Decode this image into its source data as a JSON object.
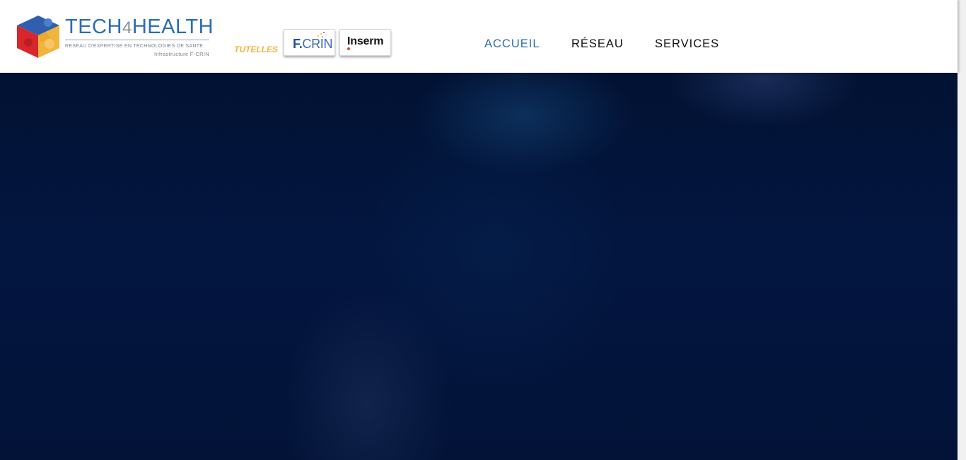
{
  "brand": {
    "name_part1": "TECH",
    "name_four": "4",
    "name_part2": "HEALTH",
    "subtitle": "RESEAU D'EXPERTISE EN TECHNOLOGIES DE SANTE",
    "subtitle2": "Infrastructure F-CRIN",
    "colors": {
      "blue": "#2a6db5",
      "red": "#d8262c",
      "yellow": "#f2b43c"
    }
  },
  "tutelles": {
    "label": "TUTELLES"
  },
  "partners": {
    "fcrin": {
      "f": "F.",
      "rest": "CRIN"
    },
    "inserm": {
      "name": "Inserm"
    }
  },
  "nav": {
    "items": [
      {
        "label": "ACCUEIL",
        "active": true
      },
      {
        "label": "RÉSEAU",
        "active": false
      },
      {
        "label": "SERVICES",
        "active": false
      }
    ],
    "colors": {
      "active": "#2a6db5",
      "default": "#111111"
    }
  },
  "hero": {
    "background": "#031640"
  }
}
